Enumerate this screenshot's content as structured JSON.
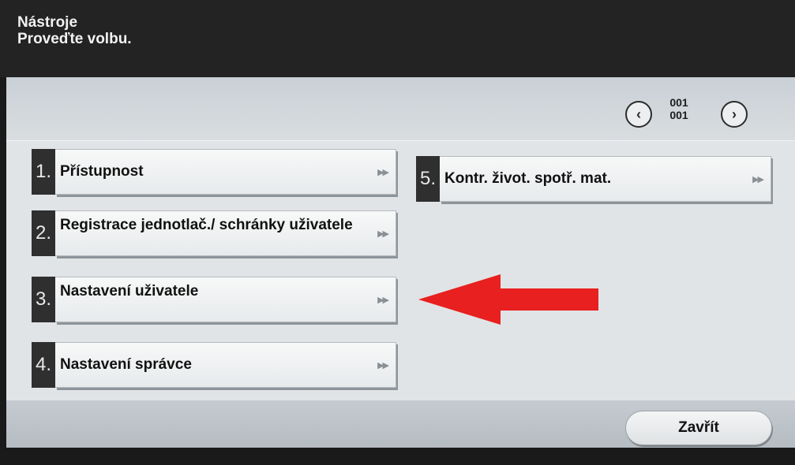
{
  "header": {
    "title": "Nástroje",
    "subtitle": "Proveďte volbu."
  },
  "pager": {
    "current": "001",
    "total": "001",
    "prev_icon": "chevron-left-icon",
    "next_icon": "chevron-right-icon"
  },
  "menu": {
    "items": [
      {
        "number": "1.",
        "label": "Přístupnost"
      },
      {
        "number": "2.",
        "label": "Registrace jednotlač./ schránky uživatele"
      },
      {
        "number": "3.",
        "label": "Nastavení uživatele"
      },
      {
        "number": "4.",
        "label": "Nastavení správce"
      },
      {
        "number": "5.",
        "label": "Kontr. život. spotř. mat."
      }
    ],
    "arrow_icon": "double-chevron-right-icon"
  },
  "footer": {
    "close_label": "Zavřít"
  },
  "annotation": {
    "color": "#e8201f",
    "icon": "red-arrow-left-icon"
  }
}
